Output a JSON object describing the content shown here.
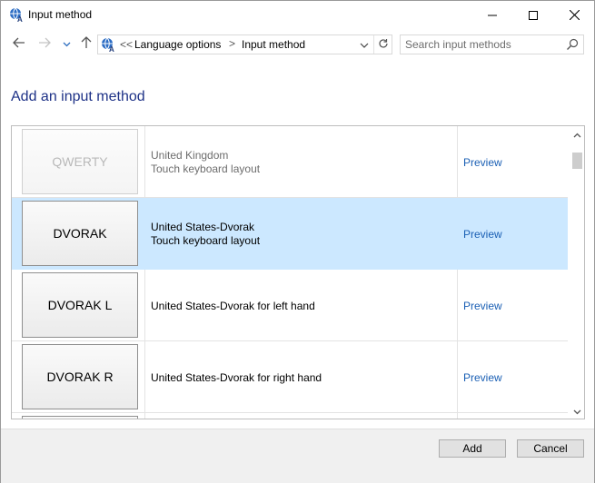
{
  "window": {
    "title": "Input method",
    "controls": {
      "minimize": "minimize",
      "maximize": "maximize",
      "close": "close"
    }
  },
  "navigation": {
    "back_icon": "arrow-left-icon",
    "forward_icon": "arrow-right-icon",
    "recent_icon": "chevron-down-icon",
    "up_icon": "arrow-up-icon",
    "address": {
      "overflow_marker": "<<",
      "breadcrumbs": [
        "Language options",
        "Input method"
      ],
      "separator": ">"
    },
    "search": {
      "placeholder": "Search input methods",
      "value": ""
    }
  },
  "main": {
    "heading": "Add an input method",
    "items": [
      {
        "key_label": "QWERTY",
        "line1": "United Kingdom",
        "line2": "Touch keyboard layout",
        "preview": "Preview",
        "state": "faded"
      },
      {
        "key_label": "DVORAK",
        "line1": "United States-Dvorak",
        "line2": "Touch keyboard layout",
        "preview": "Preview",
        "state": "selected"
      },
      {
        "key_label": "DVORAK L",
        "line1": "United States-Dvorak for left hand",
        "line2": "",
        "preview": "Preview",
        "state": "normal"
      },
      {
        "key_label": "DVORAK R",
        "line1": "United States-Dvorak for right hand",
        "line2": "",
        "preview": "Preview",
        "state": "normal"
      }
    ]
  },
  "footer": {
    "add_label": "Add",
    "cancel_label": "Cancel"
  },
  "colors": {
    "heading": "#1e3287",
    "link": "#1a5fb4",
    "selection": "#cce8ff",
    "footer_bg": "#f0f0f0"
  }
}
